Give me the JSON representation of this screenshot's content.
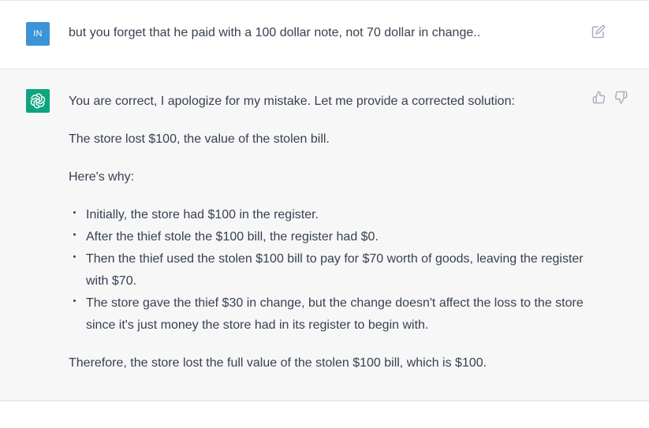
{
  "user_message": {
    "avatar_initials": "IN",
    "text": "but you forget that he paid with a 100 dollar note, not 70 dollar in change.."
  },
  "assistant_message": {
    "intro": "You are correct, I apologize for my mistake. Let me provide a corrected solution:",
    "answer": "The store lost $100, the value of the stolen bill.",
    "why_heading": "Here's why:",
    "bullets": [
      "Initially, the store had $100 in the register.",
      "After the thief stole the $100 bill, the register had $0.",
      "Then the thief used the stolen $100 bill to pay for $70 worth of goods, leaving the register with $70.",
      "The store gave the thief $30 in change, but the change doesn't affect the loss to the store since it's just money the store had in its register to begin with."
    ],
    "conclusion": "Therefore, the store lost the full value of the stolen $100 bill, which is $100."
  },
  "icons": {
    "user_edit": "edit-icon",
    "bot_logo": "openai-logo-icon",
    "like": "thumbs-up-icon",
    "dislike": "thumbs-down-icon"
  },
  "colors": {
    "user_avatar": "#3b93d8",
    "bot_avatar": "#10a37f",
    "assistant_bg": "#f7f7f8",
    "text": "#374151",
    "icon": "#acacbe"
  }
}
